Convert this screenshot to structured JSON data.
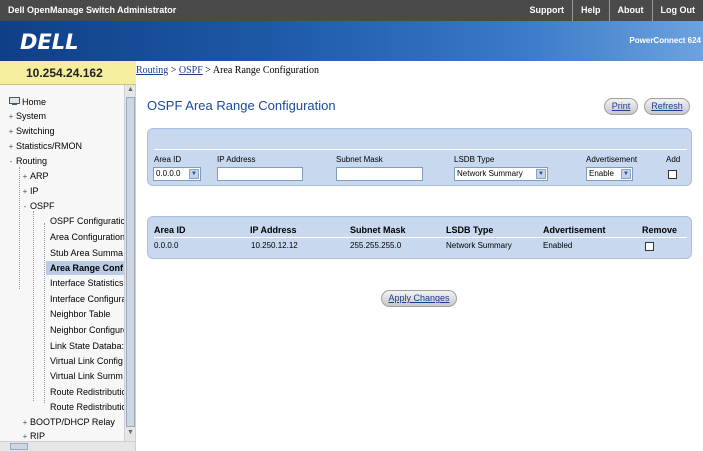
{
  "header": {
    "app_title": "Dell OpenManage Switch Administrator",
    "links": [
      "Support",
      "Help",
      "About",
      "Log Out"
    ],
    "logo": "DELL",
    "product": "PowerConnect 624"
  },
  "device_ip": "10.254.24.162",
  "breadcrumb": {
    "crumb1": "Routing",
    "sep1": " > ",
    "crumb2": "OSPF",
    "sep2": " > ",
    "current": "Area Range Configuration"
  },
  "sidebar": {
    "items": [
      {
        "label": "Home",
        "icon": "monitor-icon"
      },
      {
        "label": "System",
        "toggle": "+"
      },
      {
        "label": "Switching",
        "toggle": "+"
      },
      {
        "label": "Statistics/RMON",
        "toggle": "+"
      },
      {
        "label": "Routing",
        "toggle": "-"
      },
      {
        "label": "ARP",
        "toggle": "+"
      },
      {
        "label": "IP",
        "toggle": "+"
      },
      {
        "label": "OSPF",
        "toggle": "-"
      },
      {
        "label": "OSPF Configuratic"
      },
      {
        "label": "Area Configuration"
      },
      {
        "label": "Stub Area Summa"
      },
      {
        "label": "Area Range Conf"
      },
      {
        "label": "Interface Statistics"
      },
      {
        "label": "Interface Configura"
      },
      {
        "label": "Neighbor Table"
      },
      {
        "label": "Neighbor Configure"
      },
      {
        "label": "Link State Databa:"
      },
      {
        "label": "Virtual Link Config"
      },
      {
        "label": "Virtual Link Summ"
      },
      {
        "label": "Route Redistributic"
      },
      {
        "label": "Route Redistributic"
      },
      {
        "label": "BOOTP/DHCP Relay",
        "toggle": "+"
      },
      {
        "label": "RIP",
        "toggle": "+"
      }
    ]
  },
  "page": {
    "title": "OSPF Area Range Configuration",
    "print_label": "Print",
    "refresh_label": "Refresh",
    "apply_label": "Apply Changes"
  },
  "add_form": {
    "headers": {
      "area_id": "Area ID",
      "ip_address": "IP Address",
      "subnet_mask": "Subnet Mask",
      "lsdb_type": "LSDB Type",
      "advertisement": "Advertisement",
      "add": "Add"
    },
    "area_id_value": "0.0.0.0",
    "ip_address_value": "",
    "subnet_mask_value": "",
    "lsdb_type_value": "Network Summary",
    "advertisement_value": "Enable",
    "add_checked": false
  },
  "table": {
    "headers": {
      "area_id": "Area ID",
      "ip_address": "IP Address",
      "subnet_mask": "Subnet Mask",
      "lsdb_type": "LSDB Type",
      "advertisement": "Advertisement",
      "remove": "Remove"
    },
    "rows": [
      {
        "area_id": "0.0.0.0",
        "ip_address": "10.250.12.12",
        "subnet_mask": "255.255.255.0",
        "lsdb_type": "Network Summary",
        "advertisement": "Enabled",
        "remove_checked": false
      }
    ]
  },
  "colors": {
    "title_blue": "#1b4aa0",
    "panel_bg": "#c8d8ee",
    "selected_nav_bg": "#b9cce4",
    "topbar_bg": "#4a4a4a",
    "ip_box_bg": "#f4ee9e"
  }
}
